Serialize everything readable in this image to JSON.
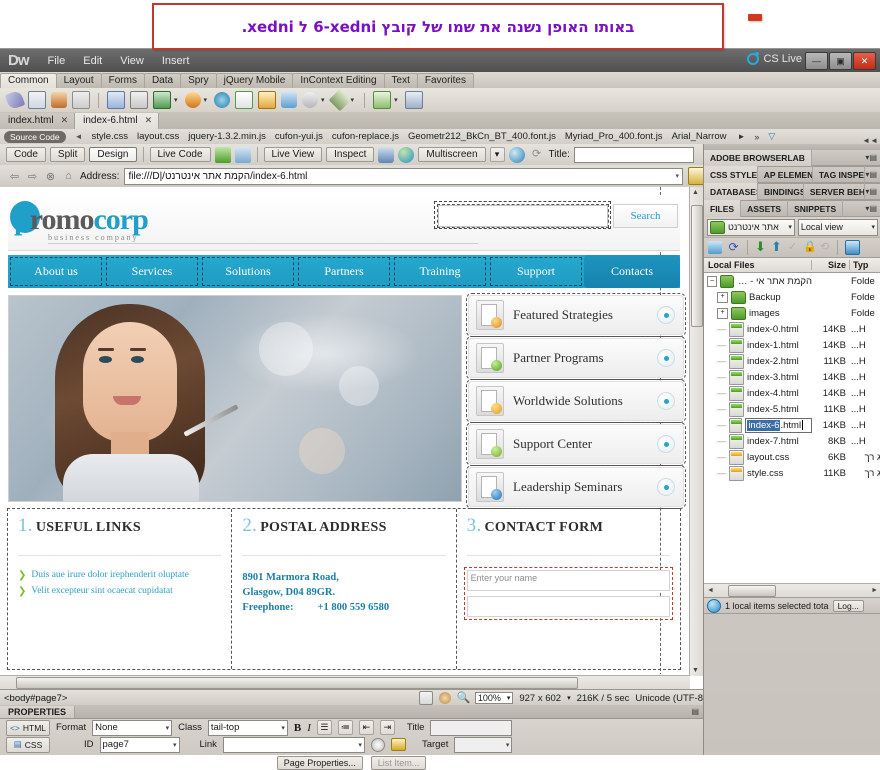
{
  "annotation": {
    "text": "באותו האופן נשנה את שמו של קובץ index-6 ל index.",
    "border_color": "#c0392b",
    "text_color": "#7B0FC4"
  },
  "app": {
    "logo": "Dw",
    "menu": [
      "File",
      "Edit",
      "View",
      "Insert"
    ],
    "cs_live_label": "CS Live",
    "window_buttons": {
      "minimize": "—",
      "maximize": "▣",
      "close": "✕"
    }
  },
  "insert_bar": {
    "tabs": [
      "Common",
      "Layout",
      "Forms",
      "Data",
      "Spry",
      "jQuery Mobile",
      "InContext Editing",
      "Text",
      "Favorites"
    ],
    "active_tab": "Common",
    "icons": [
      "hyperlink-icon",
      "email-link-icon",
      "named-anchor-icon",
      "horizontal-rule-icon",
      "table-icon",
      "image-placeholder-icon",
      "images-icon",
      "media-icon",
      "widget-icon",
      "date-icon",
      "server-side-include-icon",
      "comment-icon",
      "head-icon",
      "script-icon",
      "templates-icon",
      "tag-chooser-icon"
    ]
  },
  "document_tabs": [
    {
      "label": "index.html",
      "active": false
    },
    {
      "label": "index-6.html",
      "active": true
    }
  ],
  "related_files": {
    "source_code_label": "Source Code",
    "files": [
      "style.css",
      "layout.css",
      "jquery-1.3.2.min.js",
      "cufon-yui.js",
      "cufon-replace.js",
      "Geometr212_BkCn_BT_400.font.js",
      "Myriad_Pro_400.font.js",
      "Arial_Narrow"
    ],
    "path_label": "D:\\הקמת אתר אינטרנט\\index-6.html"
  },
  "document_toolbar": {
    "view_buttons": [
      "Code",
      "Split",
      "Design"
    ],
    "active_view": "Design",
    "live_code": "Live Code",
    "live_view": "Live View",
    "inspect": "Inspect",
    "multiscreen": "Multiscreen",
    "title_label": "Title:",
    "title_value": ""
  },
  "address_bar": {
    "label": "Address:",
    "value": "file:///D|/הקמת אתר אינטרנט/index-6.html"
  },
  "site_page": {
    "logo": {
      "part1": "p",
      "part2": "romo",
      "part3": "corp",
      "tagline": "business company"
    },
    "search": {
      "placeholder": "",
      "button_label": "Search"
    },
    "nav": [
      {
        "label": "About us",
        "active": false
      },
      {
        "label": "Services",
        "active": false
      },
      {
        "label": "Solutions",
        "active": false
      },
      {
        "label": "Partners",
        "active": false
      },
      {
        "label": "Training",
        "active": false
      },
      {
        "label": "Support",
        "active": false
      },
      {
        "label": "Contacts",
        "active": true
      }
    ],
    "features": [
      {
        "label": "Featured Strategies",
        "icon": "chart-document-icon",
        "badge_color": "#f2a93b"
      },
      {
        "label": "Partner Programs",
        "icon": "check-document-icon",
        "badge_color": "#64bf3a"
      },
      {
        "label": "Worldwide Solutions",
        "icon": "star-document-icon",
        "badge_color": "#f2a93b"
      },
      {
        "label": "Support Center",
        "icon": "hand-document-icon",
        "badge_color": "#86c442"
      },
      {
        "label": "Leadership Seminars",
        "icon": "play-document-icon",
        "badge_color": "#2f8fd6"
      }
    ],
    "columns": [
      {
        "num": "1.",
        "heading": "USEFUL LINKS",
        "links": [
          "Duis aue irure dolor irephenderit oluptate",
          "Velit excepteur sint ocaecat cupidatat"
        ]
      },
      {
        "num": "2.",
        "heading": "POSTAL ADDRESS",
        "address_line1": "8901 Marmora Road,",
        "address_line2": "Glasgow, D04 89GR.",
        "phone_label": "Freephone:",
        "phone_value": "+1 800 559 6580"
      },
      {
        "num": "3.",
        "heading": "CONTACT FORM",
        "name_placeholder": "Enter your name",
        "second_field": ""
      }
    ],
    "accent_color": "#26a8cf"
  },
  "status_bar": {
    "tag_selector": "<body#page7>",
    "zoom": "100%",
    "window_size": "927 x 602",
    "download_size": "216K / 5 sec",
    "encoding": "Unicode (UTF-8"
  },
  "properties": {
    "panel_title": "PROPERTIES",
    "html_tab": "HTML",
    "css_tab": "CSS",
    "format_label": "Format",
    "format_value": "None",
    "class_label": "Class",
    "class_value": "tail-top",
    "bold": "B",
    "italic": "I",
    "title_label": "Title",
    "title_value": "",
    "id_label": "ID",
    "id_value": "page7",
    "link_label": "Link",
    "link_value": "",
    "target_label": "Target",
    "target_value": "",
    "page_properties_button": "Page Properties...",
    "list_item_button": "List Item..."
  },
  "right_panels": {
    "browserlab": [
      "ADOBE BROWSERLAB"
    ],
    "css_group": [
      "CSS STYLES",
      "AP ELEMENT",
      "TAG INSPEC"
    ],
    "db_group": [
      "DATABASES",
      "BINDINGS",
      "SERVER BEHA"
    ],
    "files_group": [
      "FILES",
      "ASSETS",
      "SNIPPETS"
    ],
    "active_files_tab": "FILES",
    "site_selector": "אתר אינטרנט",
    "view_selector": "Local view",
    "columns": {
      "name": "Local Files",
      "size": "Size",
      "type": "Typ"
    },
    "tree": [
      {
        "name": "הקמת אתר אי - Site",
        "size": "",
        "type": "Folde",
        "indent": 0,
        "twisty": "–",
        "icon": "folder-icon",
        "editing": false
      },
      {
        "name": "Backup",
        "size": "",
        "type": "Folde",
        "indent": 1,
        "twisty": "+",
        "icon": "folder-icon",
        "editing": false
      },
      {
        "name": "images",
        "size": "",
        "type": "Folde",
        "indent": 1,
        "twisty": "+",
        "icon": "folder-icon",
        "editing": false
      },
      {
        "name": "index-0.html",
        "size": "14KB",
        "type": "...H",
        "indent": 1,
        "twisty": "",
        "icon": "html-file-icon",
        "editing": false
      },
      {
        "name": "index-1.html",
        "size": "14KB",
        "type": "...H",
        "indent": 1,
        "twisty": "",
        "icon": "html-file-icon",
        "editing": false
      },
      {
        "name": "index-2.html",
        "size": "11KB",
        "type": "...H",
        "indent": 1,
        "twisty": "",
        "icon": "html-file-icon",
        "editing": false
      },
      {
        "name": "index-3.html",
        "size": "14KB",
        "type": "...H",
        "indent": 1,
        "twisty": "",
        "icon": "html-file-icon",
        "editing": false
      },
      {
        "name": "index-4.html",
        "size": "14KB",
        "type": "...H",
        "indent": 1,
        "twisty": "",
        "icon": "html-file-icon",
        "editing": false
      },
      {
        "name": "index-5.html",
        "size": "11KB",
        "type": "...H",
        "indent": 1,
        "twisty": "",
        "icon": "html-file-icon",
        "editing": false
      },
      {
        "name": "index-6.html",
        "size": "14KB",
        "type": "...H",
        "indent": 1,
        "twisty": "",
        "icon": "html-file-icon",
        "editing": true,
        "selected_part": "index-6",
        "rest_part": ".html"
      },
      {
        "name": "index-7.html",
        "size": "8KB",
        "type": "...H",
        "indent": 1,
        "twisty": "",
        "icon": "html-file-icon",
        "editing": false
      },
      {
        "name": "layout.css",
        "size": "6KB",
        "type": "ג רך",
        "indent": 1,
        "twisty": "",
        "icon": "css-file-icon",
        "editing": false
      },
      {
        "name": "style.css",
        "size": "11KB",
        "type": "ג רך",
        "indent": 1,
        "twisty": "",
        "icon": "css-file-icon",
        "editing": false
      }
    ],
    "status_text": "1 local items selected tota",
    "log_button": "Log..."
  }
}
